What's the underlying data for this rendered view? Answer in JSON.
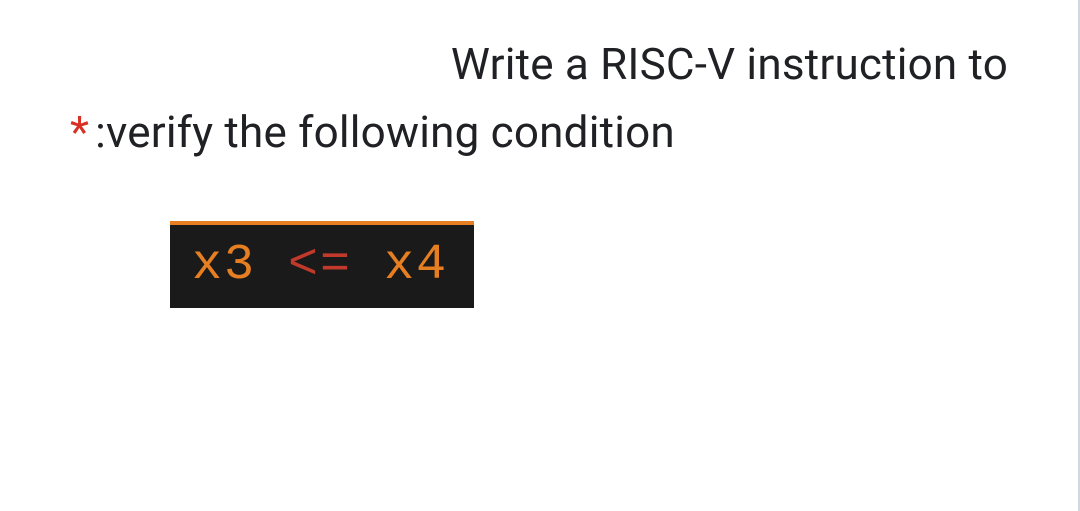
{
  "question": {
    "line1": "Write a RISC-V instruction to",
    "line2": ":verify the following condition",
    "required_mark": "*"
  },
  "code": {
    "reg1": "x3",
    "operator": "<=",
    "reg2": "x4"
  }
}
